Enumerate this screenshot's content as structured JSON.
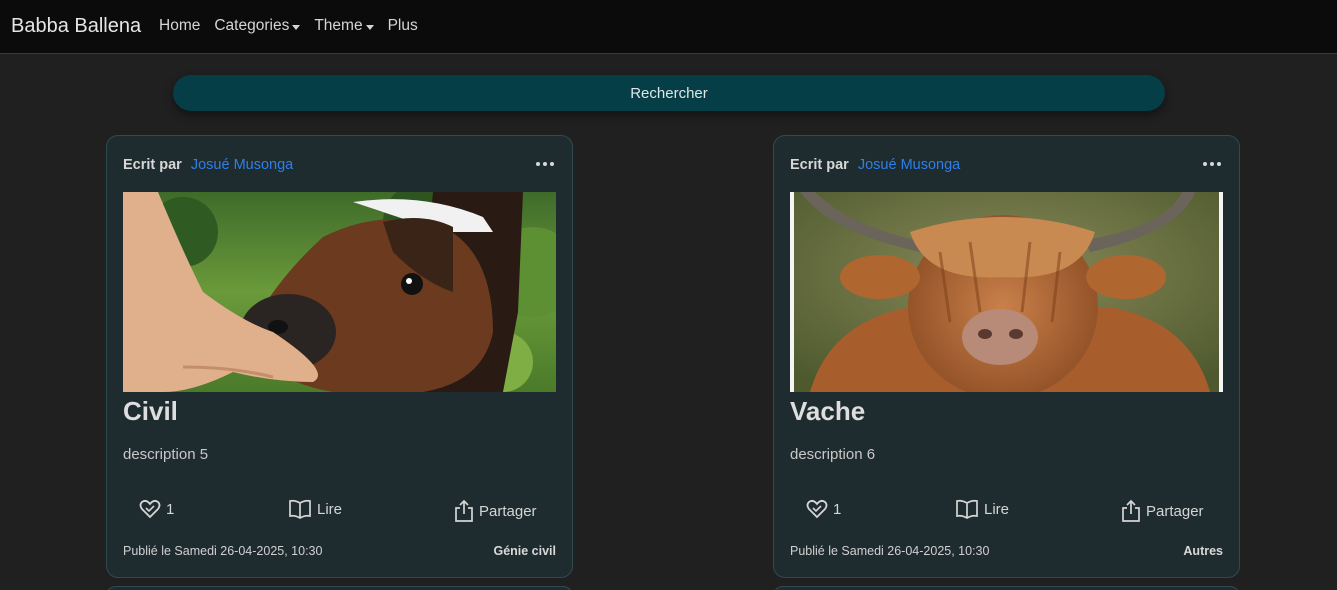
{
  "navbar": {
    "brand": "Babba Ballena",
    "items": [
      {
        "label": "Home",
        "dropdown": false
      },
      {
        "label": "Categories",
        "dropdown": true
      },
      {
        "label": "Theme",
        "dropdown": true
      },
      {
        "label": "Plus",
        "dropdown": false
      }
    ]
  },
  "search": {
    "label": "Rechercher"
  },
  "colors": {
    "background": "#202020",
    "navbar": "#0b0b0b",
    "search_button": "#053e47",
    "card": "#1f2c2f",
    "link": "#2e7fe6"
  },
  "cards": [
    {
      "author_label": "Ecrit par",
      "author_name": "Josué Musonga",
      "image": "calf-being-fed-photo",
      "title": "Civil",
      "description": "description 5",
      "likes": "1",
      "read_label": "Lire",
      "share_label": "Partager",
      "published": "Publié le Samedi 26-04-2025, 10:30",
      "category": "Génie civil"
    },
    {
      "author_label": "Ecrit par",
      "author_name": "Josué Musonga",
      "image": "highland-cow-photo",
      "title": "Vache",
      "description": "description 6",
      "likes": "1",
      "read_label": "Lire",
      "share_label": "Partager",
      "published": "Publié le Samedi 26-04-2025, 10:30",
      "category": "Autres"
    }
  ]
}
